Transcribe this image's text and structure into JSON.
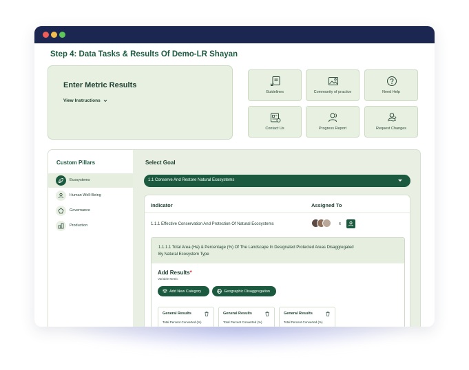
{
  "page": {
    "step_title": "Step 4: Data Tasks & Results Of Demo-LR Shayan"
  },
  "metric": {
    "title": "Enter Metric Results",
    "instructions": "View Instructions"
  },
  "tiles": [
    {
      "label": "Guidelines",
      "icon": "guidelines-icon"
    },
    {
      "label": "Community of practice",
      "icon": "image-icon"
    },
    {
      "label": "Need Help",
      "icon": "help-icon"
    },
    {
      "label": "Contact Us",
      "icon": "contact-icon"
    },
    {
      "label": "Progress Report",
      "icon": "people-icon"
    },
    {
      "label": "Request Changes",
      "icon": "request-changes-icon"
    }
  ],
  "sidebar": {
    "title": "Custom Pillars",
    "items": [
      {
        "label": "Ecosystems",
        "icon": "leaf-icon",
        "active": true
      },
      {
        "label": "Human Well-Being",
        "icon": "person-icon",
        "active": false
      },
      {
        "label": "Governance",
        "icon": "governance-icon",
        "active": false
      },
      {
        "label": "Production",
        "icon": "production-icon",
        "active": false
      }
    ]
  },
  "goal": {
    "label": "Select Goal",
    "selected": "1.1 Conserve And Restore Natural Ecosystems"
  },
  "indicator_table": {
    "col_indicator": "Indicator",
    "col_assigned": "Assigned To",
    "row_title": "1.1.1 Effective Conservation And Protection Of Natural Ecosystems",
    "assignee_count": "6"
  },
  "sub_indicator": {
    "title": "1.1.1.1 Total Area (Ha) & Percentage (%) Of The Landscape In Designated Protected Areas Disaggregated By Natural Ecosystem Type",
    "add_results": "Add Results",
    "required_mark": "*",
    "variable_metric": "Variable Metric",
    "add_category": "Add New Category",
    "geo_disaggregation": "Geographic Disaggregation"
  },
  "result_cards": [
    {
      "title": "General Results",
      "subtitle": "Total Percent Converted (%)"
    },
    {
      "title": "General Results",
      "subtitle": "Total Percent Converted (%)"
    },
    {
      "title": "General Results",
      "subtitle": "Total Percent Converted (%)"
    }
  ],
  "colors": {
    "brand_dark_green": "#1b5a3f",
    "card_green": "#e8f0e1",
    "titlebar_navy": "#1b2651"
  }
}
